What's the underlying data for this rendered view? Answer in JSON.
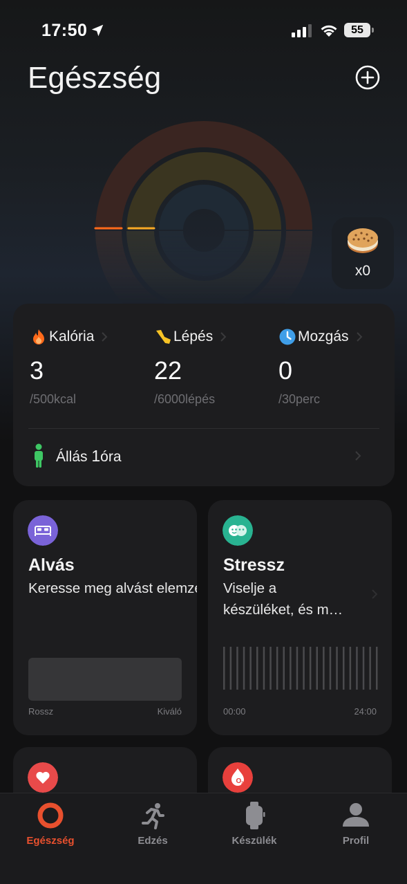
{
  "status_bar": {
    "time": "17:50",
    "battery": "55"
  },
  "header": {
    "title": "Egészség"
  },
  "colors": {
    "accent": "#e8502e",
    "calorie": "#ff6a1a",
    "steps": "#f7c325",
    "move": "#3f9ee8",
    "standing": "#3ec764",
    "sleep_icon": "#7a63d8",
    "stress_icon": "#29b391",
    "heart_icon": "#e84a4a",
    "spo2_icon": "#e8403c"
  },
  "rewards": {
    "count": "x0",
    "icon": "cookie-icon"
  },
  "activity": {
    "metrics": [
      {
        "label": "Kalória",
        "value": "3",
        "target": "/500kcal",
        "icon": "flame-icon",
        "progress": 0.006
      },
      {
        "label": "Lépés",
        "value": "22",
        "target": "/6000lépés",
        "icon": "shoe-icon",
        "progress": 0.004
      },
      {
        "label": "Mozgás",
        "value": "0",
        "target": "/30perc",
        "icon": "clock-icon",
        "progress": 0
      }
    ],
    "standing": {
      "label_prefix": "Állás ",
      "value": "1",
      "unit": "óra"
    }
  },
  "tiles": {
    "sleep": {
      "title": "Alvás",
      "description": "Keresse meg alvást elemzése",
      "scale_left": "Rossz",
      "scale_right": "Kiváló"
    },
    "stress": {
      "title": "Stressz",
      "description_line1": "Viselje a",
      "description_line2": "készüléket, és m…",
      "scale_left": "00:00",
      "scale_right": "24:00"
    }
  },
  "tab_bar": {
    "tabs": [
      {
        "label": "Egészség",
        "active": true
      },
      {
        "label": "Edzés",
        "active": false
      },
      {
        "label": "Készülék",
        "active": false
      },
      {
        "label": "Profil",
        "active": false
      }
    ]
  }
}
